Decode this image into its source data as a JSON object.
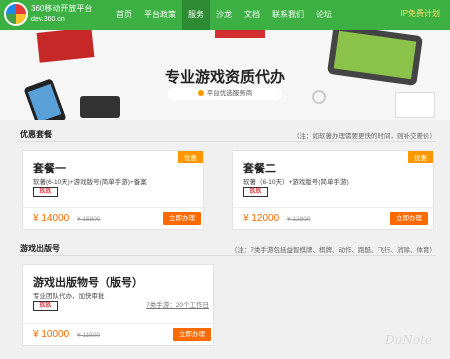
{
  "brand": {
    "name": "360移动开放平台",
    "domain": "dev.360.cn"
  },
  "nav": {
    "items": [
      "首页",
      "平台政策",
      "服务",
      "沙龙",
      "文档",
      "联系我们",
      "论坛"
    ],
    "active_index": 2,
    "cta": "IP免费计划"
  },
  "hero": {
    "title": "专业游戏资质代办",
    "badge": "平台优选服务商"
  },
  "section_packages": {
    "title": "优惠套餐",
    "note": "（注：如软著办理需要更快的时间，则补交差价）",
    "cards": [
      {
        "tag": "优惠",
        "name": "套餐一",
        "desc": "软著(6-10天)+游戏版号(简单手游)+备案",
        "logo": "玖玖",
        "price": "¥ 14000",
        "old_price": "¥ 15800",
        "buy": "立即办理"
      },
      {
        "tag": "优惠",
        "name": "套餐二",
        "desc": "软著（6-10天）+游戏版号(简单手游)",
        "logo": "玖玖",
        "price": "¥ 12000",
        "old_price": "¥ 12800",
        "buy": "立即办理"
      }
    ]
  },
  "section_license": {
    "title": "游戏出版号",
    "note": "（注：7类手游包括益智棋牌、棋牌、动作、跑酷、飞行、消除、体育）",
    "card": {
      "name": "游戏出版物号（版号）",
      "desc": "专业团队代办，加快审批",
      "logo": "玖玖",
      "extra": "7类手游：20个工作日",
      "price": "¥ 10000",
      "old_price": "¥ 11500",
      "buy": "立即办理"
    }
  },
  "watermark": "DuNote"
}
